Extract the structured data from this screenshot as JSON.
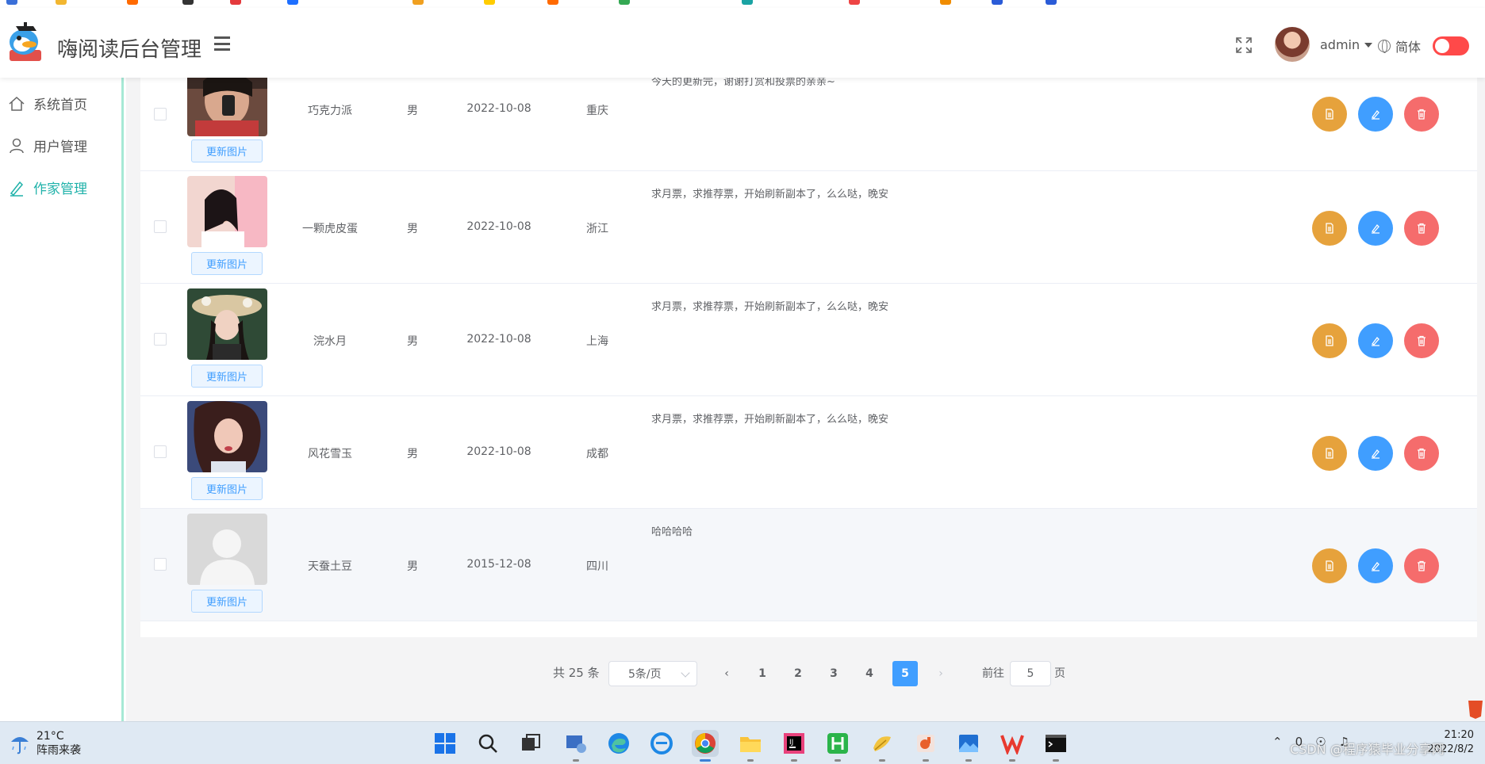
{
  "header": {
    "app_title": "嗨阅读后台管理",
    "user_name": "admin",
    "language": "简体"
  },
  "sidebar": {
    "items": [
      {
        "label": "系统首页",
        "icon": "home-icon"
      },
      {
        "label": "用户管理",
        "icon": "user-icon"
      },
      {
        "label": "作家管理",
        "icon": "pen-icon",
        "active": true
      }
    ]
  },
  "table": {
    "update_photo_label": "更新图片",
    "rows": [
      {
        "name": "巧克力派",
        "gender": "男",
        "date": "2022-10-08",
        "region": "重庆",
        "intro": "今天的更新完，谢谢打赏和投票的亲亲~",
        "photo": "photo-masked-selfie"
      },
      {
        "name": "一颗虎皮蛋",
        "gender": "男",
        "date": "2022-10-08",
        "region": "浙江",
        "intro": "求月票，求推荐票，开始刷新副本了，么么哒，晚安",
        "photo": "photo-girl-pink"
      },
      {
        "name": "浣水月",
        "gender": "男",
        "date": "2022-10-08",
        "region": "上海",
        "intro": "求月票，求推荐票，开始刷新副本了，么么哒，晚安",
        "photo": "photo-girl-flower-hat"
      },
      {
        "name": "风花雪玉",
        "gender": "男",
        "date": "2022-10-08",
        "region": "成都",
        "intro": "求月票，求推荐票，开始刷新副本了，么么哒，晚安",
        "photo": "photo-girl-curly-hair"
      },
      {
        "name": "天蚕土豆",
        "gender": "男",
        "date": "2015-12-08",
        "region": "四川",
        "intro": "哈哈哈哈",
        "photo": "photo-placeholder"
      }
    ]
  },
  "pagination": {
    "total_text": "共 25 条",
    "page_size": "5条/页",
    "pages": [
      "1",
      "2",
      "3",
      "4",
      "5"
    ],
    "current_page": "5",
    "jump_prefix": "前往",
    "jump_value": "5",
    "jump_suffix": "页"
  },
  "taskbar": {
    "temperature": "21°C",
    "weather_text": "阵雨来袭",
    "time": "21:20",
    "date": "2022/8/2",
    "tray_text": "0"
  },
  "watermark": "CSDN @程序猿毕业分享网",
  "colors": {
    "accent": "#20b2aa",
    "primary": "#409eff",
    "warning": "#e6a23c",
    "danger": "#f56c6c",
    "toggle": "#ff4949"
  }
}
